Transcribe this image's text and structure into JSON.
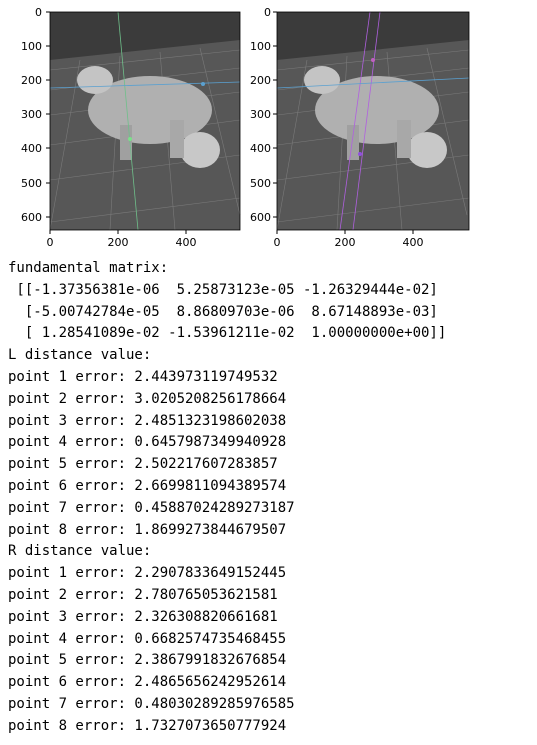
{
  "plots": [
    {
      "name": "left-image",
      "y_ticks": [
        "0",
        "100",
        "200",
        "300",
        "400",
        "500",
        "600"
      ],
      "x_ticks": [
        "0",
        "200",
        "400"
      ],
      "colors": {
        "floor": "#575757",
        "background": "#3b3b3b",
        "grid": "#7a7a7a"
      }
    },
    {
      "name": "right-image",
      "y_ticks": [
        "0",
        "100",
        "200",
        "300",
        "400",
        "500",
        "600"
      ],
      "x_ticks": [
        "0",
        "200",
        "400"
      ],
      "colors": {
        "floor": "#575757",
        "background": "#3b3b3b",
        "grid": "#7a7a7a"
      }
    }
  ],
  "output": {
    "fundamental_label": "fundamental matrix:",
    "matrix_rows": [
      " [[-1.37356381e-06  5.25873123e-05 -1.26329444e-02]",
      "  [-5.00742784e-05  8.86809703e-06  8.67148893e-03]",
      "  [ 1.28541089e-02 -1.53961211e-02  1.00000000e+00]]"
    ],
    "l_label": "L distance value:",
    "l_errors": [
      "point 1 error: 2.443973119749532",
      "point 2 error: 3.0205208256178664",
      "point 3 error: 2.4851323198602038",
      "point 4 error: 0.6457987349940928",
      "point 5 error: 2.502217607283857",
      "point 6 error: 2.6699811094389574",
      "point 7 error: 0.45887024289273187",
      "point 8 error: 1.8699273844679507"
    ],
    "r_label": "R distance value:",
    "r_errors": [
      "point 1 error: 2.2907833649152445",
      "point 2 error: 2.780765053621581",
      "point 3 error: 2.326308820661681",
      "point 4 error: 0.6682574735468455",
      "point 5 error: 2.3867991832676854",
      "point 6 error: 2.4865656242952614",
      "point 7 error: 0.48030289285976585",
      "point 8 error: 1.7327073650777924"
    ]
  }
}
